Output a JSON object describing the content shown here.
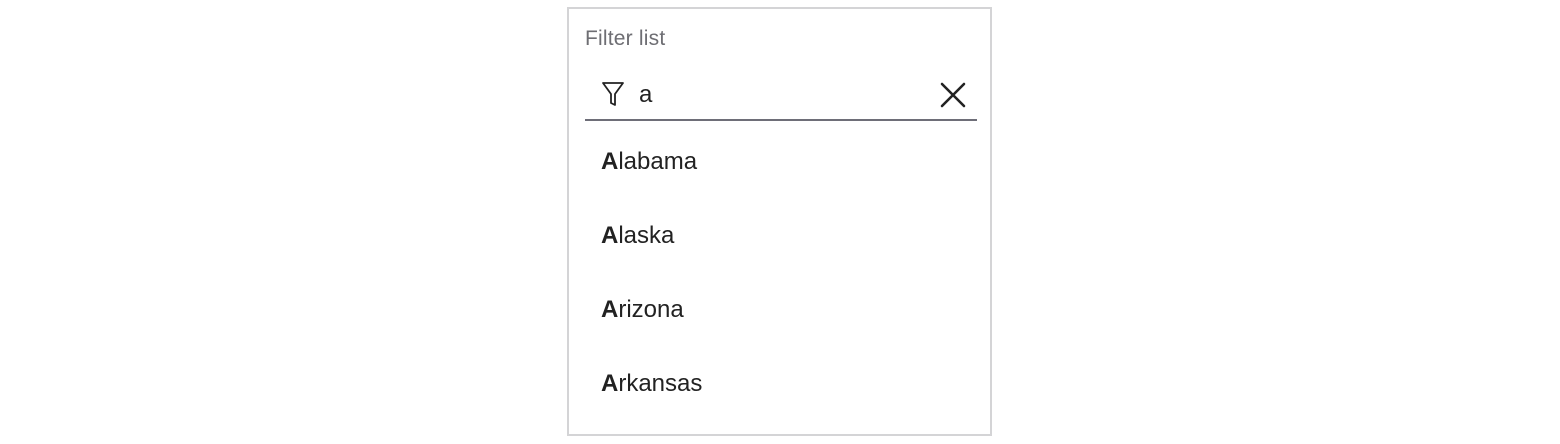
{
  "filter": {
    "label": "Filter list",
    "value": "a",
    "icon": "filter-icon",
    "clear_icon": "close-icon"
  },
  "results": [
    {
      "match": "A",
      "rest": "labama"
    },
    {
      "match": "A",
      "rest": "laska"
    },
    {
      "match": "A",
      "rest": "rizona"
    },
    {
      "match": "A",
      "rest": "rkansas"
    }
  ],
  "colors": {
    "border": "#d4d4d6",
    "underline": "#6e6e78",
    "label": "#6e6e73",
    "text": "#222222"
  }
}
